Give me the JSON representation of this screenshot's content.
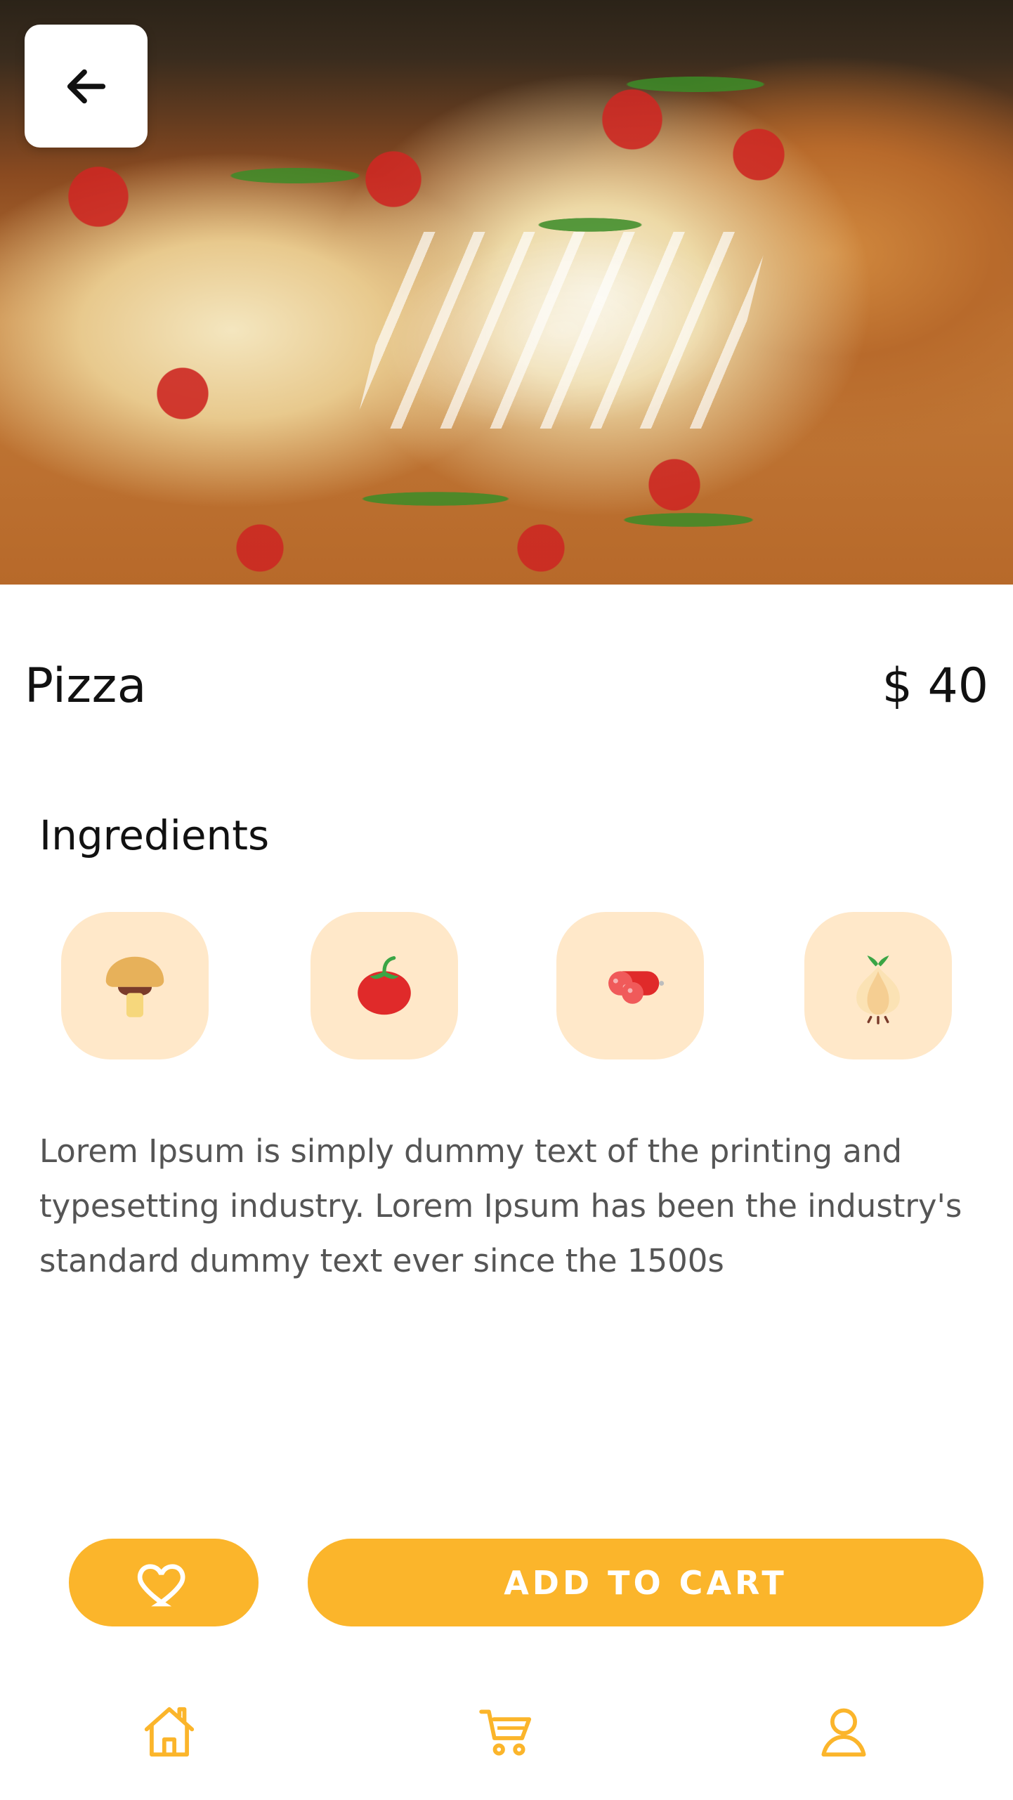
{
  "product": {
    "name": "Pizza",
    "price": "$ 40"
  },
  "ingredients": {
    "title": "Ingredients",
    "items": [
      {
        "icon": "mushroom-icon"
      },
      {
        "icon": "tomato-icon"
      },
      {
        "icon": "salami-icon"
      },
      {
        "icon": "onion-icon"
      }
    ]
  },
  "description": "Lorem Ipsum is simply dummy text of the printing and typesetting industry. Lorem Ipsum has been the industry's standard dummy text ever since the 1500s",
  "actions": {
    "add_to_cart_label": "ADD TO CART"
  },
  "bottom_nav": {
    "items": [
      {
        "icon": "home-icon"
      },
      {
        "icon": "cart-icon"
      },
      {
        "icon": "profile-icon"
      }
    ]
  },
  "colors": {
    "accent": "#fbb52b",
    "ingredient_bg": "#ffe8c9"
  }
}
